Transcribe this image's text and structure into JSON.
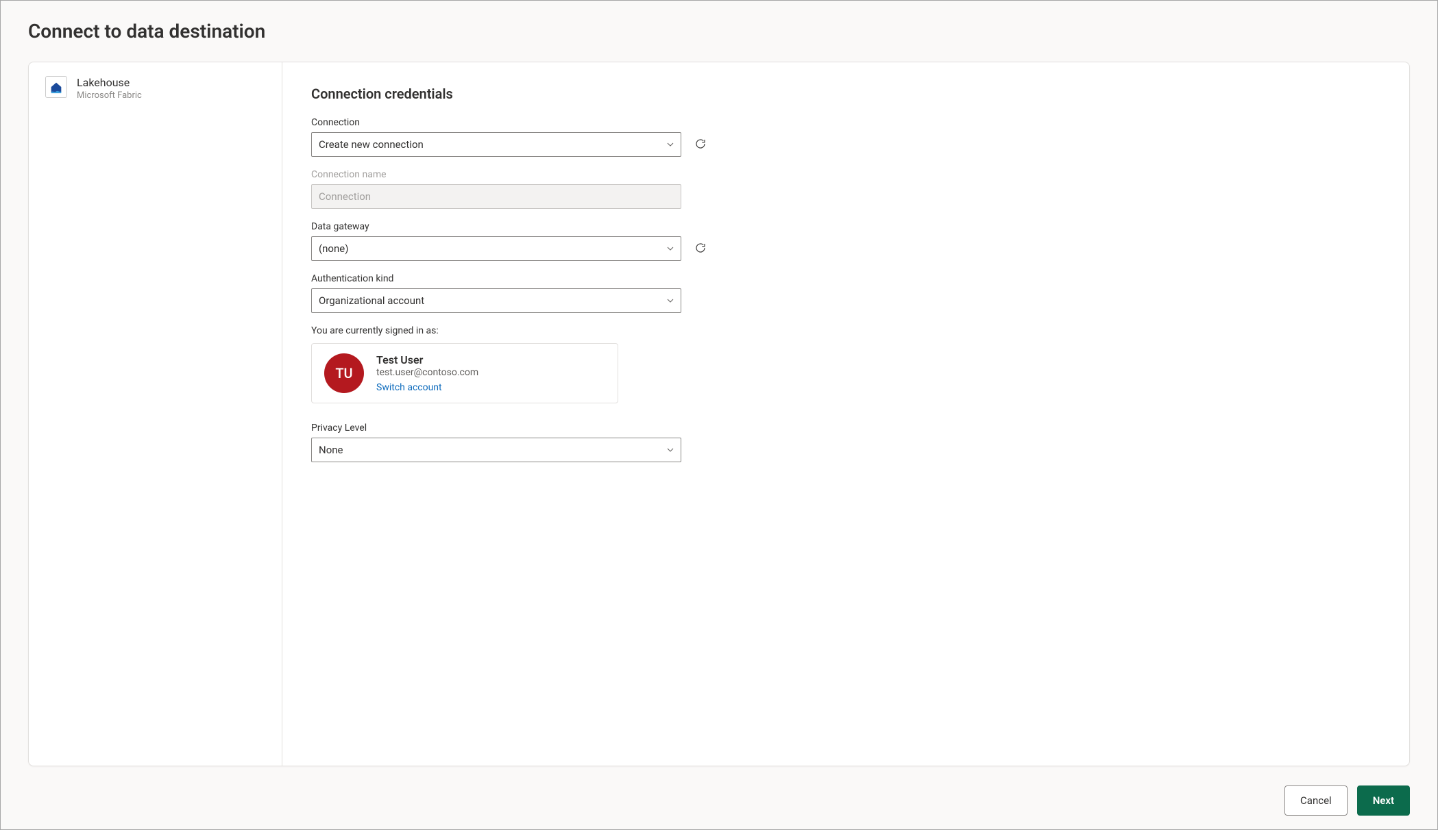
{
  "dialog": {
    "title": "Connect to data destination"
  },
  "sidebar": {
    "destination": {
      "name": "Lakehouse",
      "subtitle": "Microsoft Fabric"
    }
  },
  "main": {
    "section_title": "Connection credentials",
    "connection": {
      "label": "Connection",
      "value": "Create new connection"
    },
    "connection_name": {
      "label": "Connection name",
      "placeholder": "Connection"
    },
    "data_gateway": {
      "label": "Data gateway",
      "value": "(none)"
    },
    "auth_kind": {
      "label": "Authentication kind",
      "value": "Organizational account"
    },
    "signed_in": {
      "label": "You are currently signed in as:",
      "initials": "TU",
      "user_name": "Test User",
      "user_email": "test.user@contoso.com",
      "switch_label": "Switch account"
    },
    "privacy": {
      "label": "Privacy Level",
      "value": "None"
    }
  },
  "footer": {
    "cancel": "Cancel",
    "next": "Next"
  }
}
